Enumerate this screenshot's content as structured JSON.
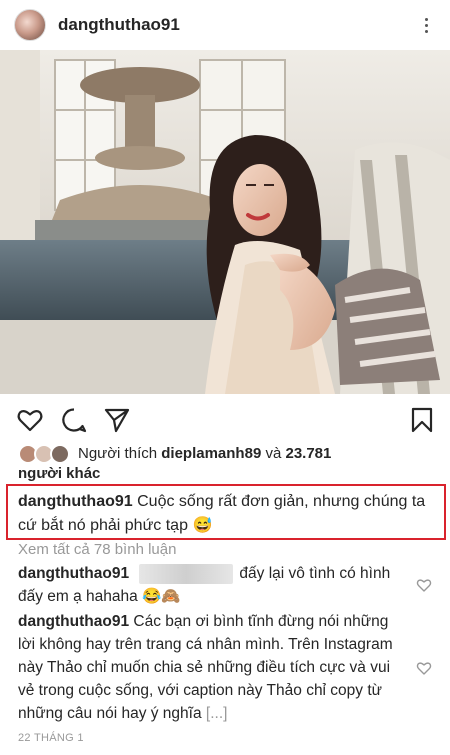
{
  "post": {
    "username": "dangthuthao91",
    "icons": {
      "more": "more-vertical-icon",
      "like": "heart-icon",
      "comment": "comment-icon",
      "share": "send-icon",
      "save": "bookmark-icon"
    }
  },
  "likes": {
    "prefix": "Người thích",
    "user": "dieplamanh89",
    "and": "và",
    "count": "23.781",
    "suffix": "người khác"
  },
  "caption": {
    "username": "dangthuthao91",
    "text": "Cuộc sống rất đơn giản, nhưng chúng ta cứ bắt nó phải phức tạp",
    "emoji": "😅"
  },
  "view_all": "Xem tất cả 78 bình luận",
  "comments": [
    {
      "username": "dangthuthao91",
      "text_after": "đấy lại vô tình có hình đấy em ạ hahaha",
      "emoji": "😂🙈"
    },
    {
      "username": "dangthuthao91",
      "text": "Các bạn ơi bình tĩnh đừng nói những lời không hay trên trang cá nhân mình. Trên Instagram này Thảo chỉ muốn chia sẻ những điều tích cực và vui vẻ trong cuộc sống, với caption này Thảo chỉ copy từ những câu nói hay ý nghĩa",
      "more": "[...]"
    }
  ],
  "date": "22 THÁNG 1",
  "colors": {
    "highlight_border": "#d9232d",
    "muted_text": "#999999"
  }
}
